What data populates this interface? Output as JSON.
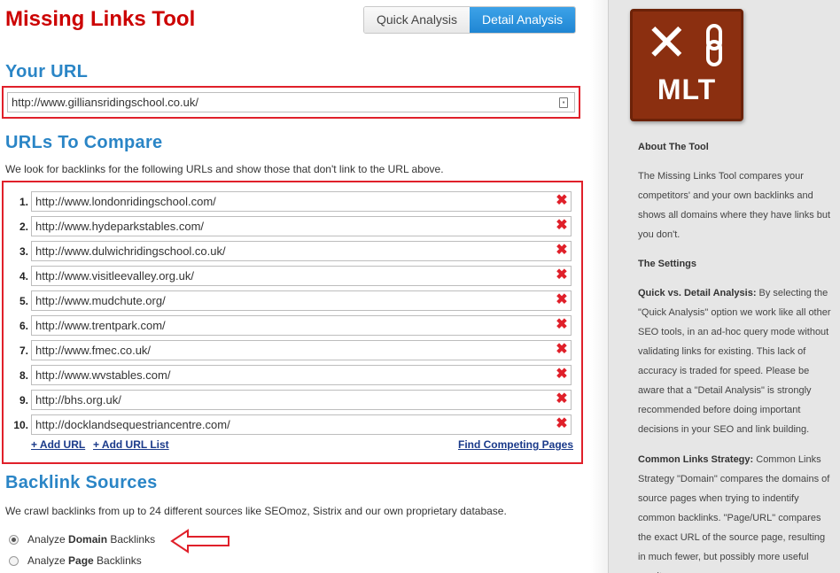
{
  "header": {
    "title": "Missing Links Tool",
    "mode_toggle": {
      "quick_label": "Quick Analysis",
      "detail_label": "Detail Analysis",
      "active": "Detail Analysis"
    }
  },
  "your_url": {
    "heading": "Your URL",
    "value": "http://www.gilliansridingschool.co.uk/"
  },
  "compare": {
    "heading": "URLs To Compare",
    "description": "We look for backlinks for the following URLs and show those that don't link to the URL above.",
    "rows": [
      {
        "num": "1.",
        "url": "http://www.londonridingschool.com/"
      },
      {
        "num": "2.",
        "url": "http://www.hydeparkstables.com/"
      },
      {
        "num": "3.",
        "url": "http://www.dulwichridingschool.co.uk/"
      },
      {
        "num": "4.",
        "url": "http://www.visitleevalley.org.uk/"
      },
      {
        "num": "5.",
        "url": "http://www.mudchute.org/"
      },
      {
        "num": "6.",
        "url": "http://www.trentpark.com/"
      },
      {
        "num": "7.",
        "url": "http://www.fmec.co.uk/"
      },
      {
        "num": "8.",
        "url": "http://www.wvstables.com/"
      },
      {
        "num": "9.",
        "url": "http://bhs.org.uk/"
      },
      {
        "num": "10.",
        "url": "http://docklandsequestriancentre.com/"
      }
    ],
    "add_url_label": "+ Add URL",
    "add_url_list_label": "+ Add URL List",
    "find_competing_label": "Find Competing Pages"
  },
  "backlinks": {
    "heading": "Backlink Sources",
    "description": "We crawl backlinks from up to 24 different sources like SEOmoz, Sistrix and our own proprietary database.",
    "options": [
      {
        "pre": "Analyze ",
        "bold": "Domain",
        "post": " Backlinks",
        "checked": true
      },
      {
        "pre": "Analyze ",
        "bold": "Page",
        "post": " Backlinks",
        "checked": false
      }
    ]
  },
  "sidebar": {
    "logo_text": "MLT",
    "about_heading": "About The Tool",
    "about_text": "The Missing Links Tool compares your competitors' and your own backlinks and shows all domains where they have links but you don't.",
    "settings_heading": "The Settings",
    "quick_label": "Quick vs. Detail Analysis:",
    "quick_text": " By selecting the \"Quick Analysis\" option we work like all other SEO tools, in an ad-hoc query mode without validating links for existing. This lack of accuracy is traded for speed. Please be aware that a \"Detail Analysis\" is strongly recommended before doing important decisions in your SEO and link building.",
    "common_label": "Common Links Strategy:",
    "common_text": " Common Links Strategy \"Domain\" compares the domains of source pages when trying to indentify common backlinks. \"Page/URL\" compares the exact URL of the source page, resulting in much fewer, but possibly more useful results."
  },
  "colors": {
    "brand_red": "#cc0000",
    "heading_blue": "#2a85c6",
    "highlight_red": "#e0202a",
    "toggle_active": "#1f86d3",
    "logo_brown": "#8b2f10"
  },
  "icons": [
    "close-x-icon",
    "contact-card-icon",
    "arrow-left-icon",
    "chain-link-icon"
  ]
}
